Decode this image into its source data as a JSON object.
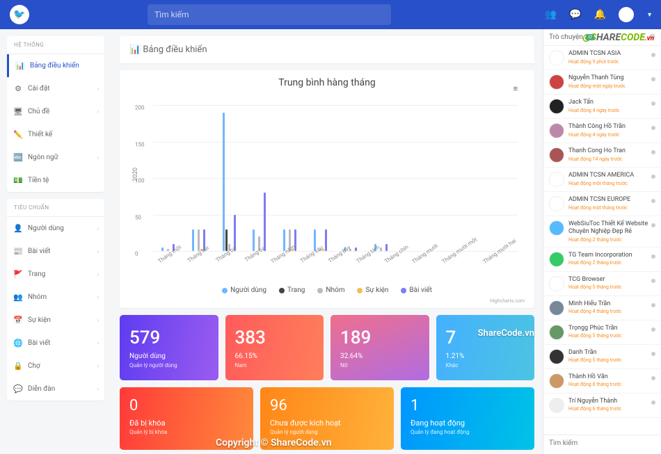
{
  "search_placeholder": "Tìm kiếm",
  "watermark": {
    "text": "SHARECODE",
    "suffix": ".vn"
  },
  "sidebar": {
    "groups": [
      {
        "title": "HỆ THỐNG",
        "items": [
          {
            "icon": "📊",
            "label": "Bảng điều khiển",
            "active": true,
            "chev": false
          },
          {
            "icon": "⚙",
            "label": "Cài đặt",
            "chev": true
          },
          {
            "icon": "🖥",
            "label": "Chủ đề",
            "chev": true
          },
          {
            "icon": "✏️",
            "label": "Thiết kế",
            "chev": false
          },
          {
            "icon": "🔤",
            "label": "Ngôn ngữ",
            "chev": true
          },
          {
            "icon": "💵",
            "label": "Tiền tệ",
            "chev": false
          }
        ]
      },
      {
        "title": "TIÊU CHUẨN",
        "items": [
          {
            "icon": "👤",
            "label": "Người dùng",
            "color": "#e74c3c",
            "chev": true
          },
          {
            "icon": "📰",
            "label": "Bài viết",
            "color": "#e67e22",
            "chev": true
          },
          {
            "icon": "🚩",
            "label": "Trang",
            "color": "#e74c3c",
            "chev": true
          },
          {
            "icon": "👥",
            "label": "Nhóm",
            "chev": true
          },
          {
            "icon": "📅",
            "label": "Sự kiện",
            "color": "#e74c3c",
            "chev": true
          },
          {
            "icon": "🌐",
            "label": "Bài viết",
            "color": "#e74c3c",
            "chev": true
          },
          {
            "icon": "🔒",
            "label": "Chợ",
            "color": "#c0392b",
            "chev": true
          },
          {
            "icon": "💬",
            "label": "Diễn đàn",
            "color": "#e74c3c",
            "chev": true
          }
        ]
      }
    ]
  },
  "panel_title": "Bảng điều khiển",
  "chart_data": {
    "type": "bar",
    "title": "Trung bình hàng tháng",
    "ylabel": "2020",
    "ylim": [
      0,
      200
    ],
    "yticks": [
      0,
      50,
      100,
      150,
      200
    ],
    "categories": [
      "Tháng một",
      "Tháng hai",
      "Tháng ba",
      "Tháng tư",
      "Tháng năm",
      "Tháng sáu",
      "Tháng bảy",
      "Tháng tám",
      "Tháng chín",
      "Tháng mười",
      "Tháng mười một",
      "Tháng mười hai"
    ],
    "series": [
      {
        "name": "Người dùng",
        "color": "#6fb7ff",
        "values": [
          5,
          30,
          190,
          30,
          30,
          30,
          5,
          10,
          0,
          0,
          0,
          0
        ]
      },
      {
        "name": "Trang",
        "color": "#444",
        "values": [
          0,
          0,
          30,
          0,
          0,
          0,
          0,
          0,
          0,
          0,
          0,
          0
        ]
      },
      {
        "name": "Nhóm",
        "color": "#bbb",
        "values": [
          3,
          30,
          10,
          20,
          30,
          3,
          3,
          5,
          0,
          0,
          0,
          0
        ]
      },
      {
        "name": "Sự kiện",
        "color": "#f0c050",
        "values": [
          0,
          3,
          0,
          0,
          3,
          3,
          0,
          0,
          0,
          0,
          0,
          0
        ]
      },
      {
        "name": "Bài viết",
        "color": "#7e7cf0",
        "values": [
          10,
          30,
          50,
          80,
          30,
          30,
          5,
          10,
          0,
          0,
          0,
          0
        ]
      }
    ],
    "credit": "Highcharts.com"
  },
  "stat_cards": [
    {
      "num": "579",
      "cap": "Người dùng",
      "sub": "Quản lý người dùng",
      "cls": "c1"
    },
    {
      "num": "383",
      "cap": "66.15%",
      "sub": "Nam",
      "cls": "c2"
    },
    {
      "num": "189",
      "cap": "32.64%",
      "sub": "Nữ",
      "cls": "c3"
    },
    {
      "num": "7",
      "cap": "1.21%",
      "sub": "Khác",
      "cls": "c4"
    }
  ],
  "stat_cards2": [
    {
      "num": "0",
      "cap": "Đã bị khóa",
      "sub": "Quản lý bị khóa",
      "cls": "d1"
    },
    {
      "num": "96",
      "cap": "Chưa được kích hoạt",
      "sub": "Quản lý người dùng",
      "cls": "d2"
    },
    {
      "num": "1",
      "cap": "Đang hoạt động",
      "sub": "Quản lý đang hoạt động",
      "cls": "d3"
    }
  ],
  "copy": "Copyright © ShareCode.vn",
  "sc_wm": "ShareCode.vn",
  "chat": {
    "title": "Trò chuyện",
    "count": "0",
    "items": [
      {
        "name": "ADMIN TCSN ASIA",
        "status": "Hoạt động 9 phút trước",
        "avc": "#fff"
      },
      {
        "name": "Nguyễn Thanh Tùng",
        "status": "Hoạt động một ngày trước",
        "avc": "#c44"
      },
      {
        "name": "Jack Tấn",
        "status": "Hoạt động 4 ngày trước",
        "avc": "#222"
      },
      {
        "name": "Thành Công Hồ Trần",
        "status": "Hoạt động 4 ngày trước",
        "avc": "#b8a"
      },
      {
        "name": "Thanh Cong Ho Tran",
        "status": "Hoạt động 14 ngày trước",
        "avc": "#a55"
      },
      {
        "name": "ADMIN TCSN AMERICA",
        "status": "Hoạt động một tháng trước",
        "avc": "#fff"
      },
      {
        "name": "ADMIN TCSN EUROPE",
        "status": "Hoạt động một tháng trước",
        "avc": "#fff"
      },
      {
        "name": "WebSiuToc Thiết Kế Website Chuyên Nghiệp Đẹp Rẻ",
        "status": "Hoạt động 2 tháng trước",
        "avc": "#5bf"
      },
      {
        "name": "TG Team Incorporation",
        "status": "Hoạt động 2 tháng trước",
        "avc": "#3c6"
      },
      {
        "name": "TCG Browser",
        "status": "Hoạt động 5 tháng trước",
        "avc": "#fff"
      },
      {
        "name": "Minh Hiếu Trần",
        "status": "Hoạt động 4 tháng trước",
        "avc": "#789"
      },
      {
        "name": "Trọngg Phúc Trần",
        "status": "Hoạt động 5 tháng trước",
        "avc": "#696"
      },
      {
        "name": "Danh Trần",
        "status": "Hoạt động 5 tháng trước",
        "avc": "#333"
      },
      {
        "name": "Thành Hồ Văn",
        "status": "Hoạt động 8 tháng trước",
        "avc": "#c96"
      },
      {
        "name": "Trí Nguyễn Thành",
        "status": "Hoạt động 6 tháng trước",
        "avc": "#eee"
      }
    ],
    "search_placeholder": "Tìm kiếm"
  }
}
